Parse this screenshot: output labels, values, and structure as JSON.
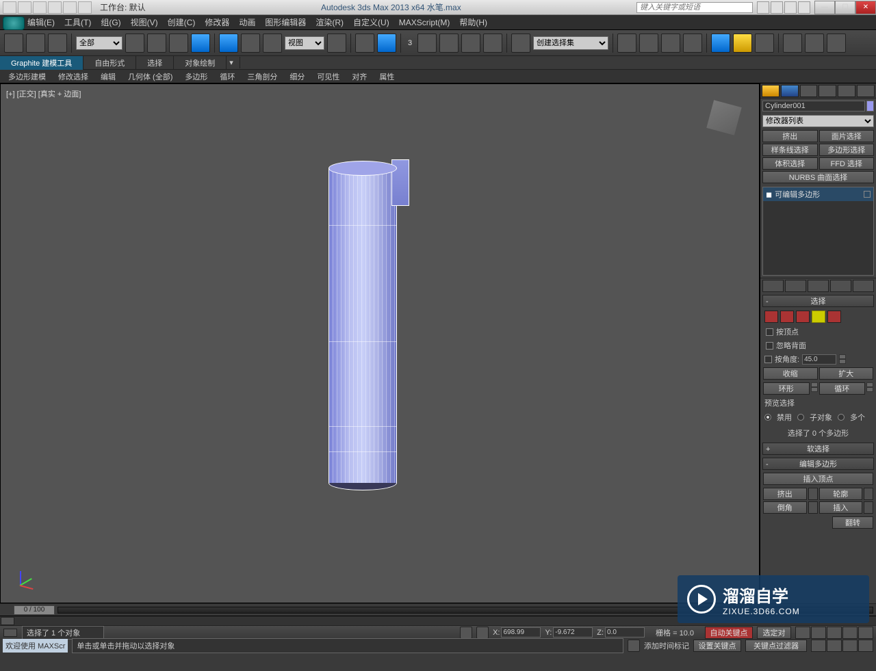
{
  "title": "Autodesk 3ds Max  2013 x64   水笔.max",
  "workspace_label": "工作台: 默认",
  "search_placeholder": "键入关键字或短语",
  "menu": [
    "编辑(E)",
    "工具(T)",
    "组(G)",
    "视图(V)",
    "创建(C)",
    "修改器",
    "动画",
    "图形编辑器",
    "渲染(R)",
    "自定义(U)",
    "MAXScript(M)",
    "帮助(H)"
  ],
  "toolbar": {
    "filter_all": "全部",
    "view_dd": "视图",
    "selset_dd": "创建选择集",
    "spinner": "3"
  },
  "ribbon": {
    "tabs": [
      "Graphite 建模工具",
      "自由形式",
      "选择",
      "对象绘制"
    ],
    "sub": [
      "多边形建模",
      "修改选择",
      "编辑",
      "几何体 (全部)",
      "多边形",
      "循环",
      "三角剖分",
      "细分",
      "可见性",
      "对齐",
      "属性"
    ]
  },
  "viewport": {
    "label": "[+] [正交] [真实 + 边面]"
  },
  "panel": {
    "object_name": "Cylinder001",
    "modifier_dd": "修改器列表",
    "mod_btns": [
      "挤出",
      "面片选择",
      "样条线选择",
      "多边形选择",
      "体积选择",
      "FFD 选择",
      "NURBS 曲面选择"
    ],
    "stack_item": "可编辑多边形",
    "rollouts": {
      "selection": "选择",
      "soft_sel": "软选择",
      "edit_poly": "编辑多边形"
    },
    "sel": {
      "by_vertex": "按顶点",
      "ignore_back": "忽略背面",
      "by_angle": "按角度:",
      "angle_val": "45.0",
      "shrink": "收缩",
      "grow": "扩大",
      "ring": "环形",
      "loop": "循环",
      "preview": "预览选择",
      "disable": "禁用",
      "subobj": "子对象",
      "multi": "多个",
      "info": "选择了 0 个多边形"
    },
    "edit": {
      "insert_vtx": "插入顶点",
      "extrude": "挤出",
      "outline": "轮廓",
      "bevel": "倒角",
      "inset": "插入",
      "flip": "翻转"
    }
  },
  "timeline": {
    "pos": "0 / 100"
  },
  "status": {
    "selection": "选择了 1 个对象",
    "x_label": "X:",
    "x": "698.99",
    "y_label": "Y:",
    "y": "-9.672",
    "z_label": "Z:",
    "z": "0.0",
    "grid": "栅格 = 10.0",
    "autokey": "自动关键点",
    "selkey": "选定对",
    "welcome": "欢迎使用  MAXScr",
    "prompt": "单击或单击并拖动以选择对象",
    "addtime": "添加时间标记",
    "setkey": "设置关键点",
    "keyfilter": "关键点过滤器"
  },
  "watermark": {
    "main": "溜溜自学",
    "sub": "ZIXUE.3D66.COM"
  }
}
